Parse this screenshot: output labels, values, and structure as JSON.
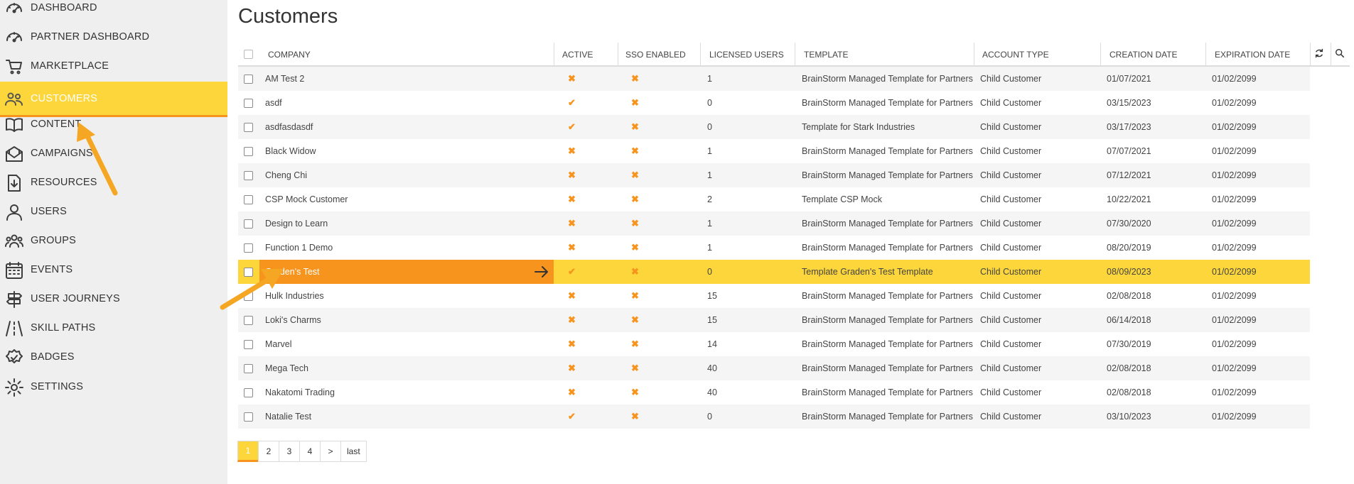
{
  "sidebar": {
    "items": [
      {
        "label": "DASHBOARD",
        "icon": "gauge-icon"
      },
      {
        "label": "PARTNER DASHBOARD",
        "icon": "gauge-icon"
      },
      {
        "label": "MARKETPLACE",
        "icon": "cart-icon"
      },
      {
        "label": "CUSTOMERS",
        "icon": "people-icon",
        "active": true
      },
      {
        "label": "CONTENT",
        "icon": "book-icon"
      },
      {
        "label": "CAMPAIGNS",
        "icon": "envelope-icon"
      },
      {
        "label": "RESOURCES",
        "icon": "download-document-icon"
      },
      {
        "label": "USERS",
        "icon": "person-icon"
      },
      {
        "label": "GROUPS",
        "icon": "group-icon"
      },
      {
        "label": "EVENTS",
        "icon": "calendar-icon"
      },
      {
        "label": "USER JOURNEYS",
        "icon": "signpost-icon"
      },
      {
        "label": "SKILL PATHS",
        "icon": "road-icon"
      },
      {
        "label": "BADGES",
        "icon": "badge-icon"
      },
      {
        "label": "SETTINGS",
        "icon": "gear-icon"
      }
    ]
  },
  "page": {
    "title": "Customers"
  },
  "table": {
    "columns": [
      "COMPANY",
      "ACTIVE",
      "SSO ENABLED",
      "LICENSED USERS",
      "TEMPLATE",
      "ACCOUNT TYPE",
      "CREATION DATE",
      "EXPIRATION DATE"
    ],
    "rows": [
      {
        "company": "AM Test 2",
        "active": false,
        "sso": false,
        "licensed": "1",
        "template": "BrainStorm Managed Template for Partners",
        "account_type": "Child Customer",
        "created": "01/07/2021",
        "expires": "01/02/2099"
      },
      {
        "company": "asdf",
        "active": true,
        "sso": false,
        "licensed": "0",
        "template": "BrainStorm Managed Template for Partners",
        "account_type": "Child Customer",
        "created": "03/15/2023",
        "expires": "01/02/2099"
      },
      {
        "company": "asdfasdasdf",
        "active": true,
        "sso": false,
        "licensed": "0",
        "template": "Template for Stark Industries",
        "account_type": "Child Customer",
        "created": "03/17/2023",
        "expires": "01/02/2099"
      },
      {
        "company": "Black Widow",
        "active": false,
        "sso": false,
        "licensed": "1",
        "template": "BrainStorm Managed Template for Partners",
        "account_type": "Child Customer",
        "created": "07/07/2021",
        "expires": "01/02/2099"
      },
      {
        "company": "Cheng Chi",
        "active": false,
        "sso": false,
        "licensed": "1",
        "template": "BrainStorm Managed Template for Partners",
        "account_type": "Child Customer",
        "created": "07/12/2021",
        "expires": "01/02/2099"
      },
      {
        "company": "CSP Mock Customer",
        "active": false,
        "sso": false,
        "licensed": "2",
        "template": "Template CSP Mock",
        "account_type": "Child Customer",
        "created": "10/22/2021",
        "expires": "01/02/2099"
      },
      {
        "company": "Design to Learn",
        "active": false,
        "sso": false,
        "licensed": "1",
        "template": "BrainStorm Managed Template for Partners",
        "account_type": "Child Customer",
        "created": "07/30/2020",
        "expires": "01/02/2099"
      },
      {
        "company": "Function 1 Demo",
        "active": false,
        "sso": false,
        "licensed": "1",
        "template": "BrainStorm Managed Template for Partners",
        "account_type": "Child Customer",
        "created": "08/20/2019",
        "expires": "01/02/2099"
      },
      {
        "company": "Graden's Test",
        "active": true,
        "sso": false,
        "licensed": "0",
        "template": "Template Graden's Test Template",
        "account_type": "Child Customer",
        "created": "08/09/2023",
        "expires": "01/02/2099",
        "highlighted": true
      },
      {
        "company": "Hulk Industries",
        "active": false,
        "sso": false,
        "licensed": "15",
        "template": "BrainStorm Managed Template for Partners",
        "account_type": "Child Customer",
        "created": "02/08/2018",
        "expires": "01/02/2099"
      },
      {
        "company": "Loki's Charms",
        "active": false,
        "sso": false,
        "licensed": "15",
        "template": "BrainStorm Managed Template for Partners",
        "account_type": "Child Customer",
        "created": "06/14/2018",
        "expires": "01/02/2099"
      },
      {
        "company": "Marvel",
        "active": false,
        "sso": false,
        "licensed": "14",
        "template": "BrainStorm Managed Template for Partners",
        "account_type": "Child Customer",
        "created": "07/30/2019",
        "expires": "01/02/2099"
      },
      {
        "company": "Mega Tech",
        "active": false,
        "sso": false,
        "licensed": "40",
        "template": "BrainStorm Managed Template for Partners",
        "account_type": "Child Customer",
        "created": "02/08/2018",
        "expires": "01/02/2099"
      },
      {
        "company": "Nakatomi Trading",
        "active": false,
        "sso": false,
        "licensed": "40",
        "template": "BrainStorm Managed Template for Partners",
        "account_type": "Child Customer",
        "created": "02/08/2018",
        "expires": "01/02/2099"
      },
      {
        "company": "Natalie Test",
        "active": true,
        "sso": false,
        "licensed": "0",
        "template": "BrainStorm Managed Template for Partners",
        "account_type": "Child Customer",
        "created": "03/10/2023",
        "expires": "01/02/2099"
      }
    ]
  },
  "pagination": {
    "pages": [
      "1",
      "2",
      "3",
      "4",
      ">",
      "last"
    ],
    "current": "1"
  },
  "glyphs": {
    "check": "✔",
    "cross": "✖"
  },
  "colors": {
    "accent_yellow": "#fcd63a",
    "accent_orange": "#f7941d"
  }
}
